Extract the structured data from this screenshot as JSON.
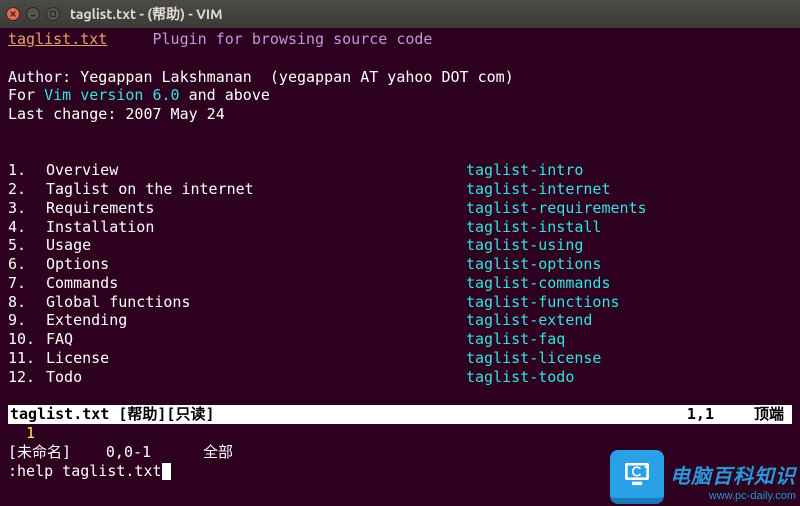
{
  "window": {
    "title": "taglist.txt - (帮助) - VIM"
  },
  "header": {
    "filename": "taglist.txt",
    "subtitle": "Plugin for browsing source code"
  },
  "meta": {
    "author_label": "Author:",
    "author_name": "Yegappan Lakshmanan  (yegappan AT yahoo DOT com)",
    "for_prefix": "For ",
    "for_link": "Vim version 6.0",
    "for_suffix": " and above",
    "last_change": "Last change: 2007 May 24"
  },
  "toc": [
    {
      "idx": "1.",
      "label": "Overview",
      "tag": "taglist-intro"
    },
    {
      "idx": "2.",
      "label": "Taglist on the internet",
      "tag": "taglist-internet"
    },
    {
      "idx": "3.",
      "label": "Requirements",
      "tag": "taglist-requirements"
    },
    {
      "idx": "4.",
      "label": "Installation",
      "tag": "taglist-install"
    },
    {
      "idx": "5.",
      "label": "Usage",
      "tag": "taglist-using"
    },
    {
      "idx": "6.",
      "label": "Options",
      "tag": "taglist-options"
    },
    {
      "idx": "7.",
      "label": "Commands",
      "tag": "taglist-commands"
    },
    {
      "idx": "8.",
      "label": "Global functions",
      "tag": "taglist-functions"
    },
    {
      "idx": "9.",
      "label": "Extending",
      "tag": "taglist-extend"
    },
    {
      "idx": "10.",
      "label": "FAQ",
      "tag": "taglist-faq"
    },
    {
      "idx": "11.",
      "label": "License",
      "tag": "taglist-license"
    },
    {
      "idx": "12.",
      "label": "Todo",
      "tag": "taglist-todo"
    }
  ],
  "status1": {
    "left": "taglist.txt [帮助][只读]",
    "pos": "1,1",
    "pct": "顶端"
  },
  "buffer2_line": "  1 ",
  "status2": {
    "left": "[未命名]",
    "pos": "0,0-1",
    "pct": "全部"
  },
  "cmdline": ":help taglist.txt",
  "watermark": {
    "cn": "电脑百科知识",
    "url": "www.pc-daily.com"
  }
}
